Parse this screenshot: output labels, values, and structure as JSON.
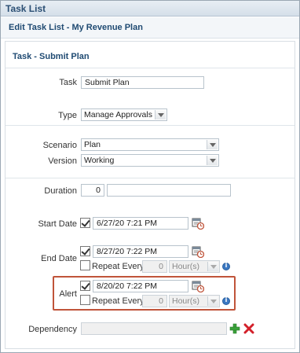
{
  "window": {
    "title": "Task List"
  },
  "header": {
    "subtitle": "Edit Task List - My Revenue Plan"
  },
  "section": {
    "title": "Task - Submit Plan"
  },
  "form": {
    "task": {
      "label": "Task",
      "value": "Submit Plan"
    },
    "type": {
      "label": "Type",
      "value": "Manage Approvals"
    },
    "scenario": {
      "label": "Scenario",
      "value": "Plan"
    },
    "version": {
      "label": "Version",
      "value": "Working"
    },
    "duration": {
      "label": "Duration",
      "value": "0",
      "unit_value": ""
    },
    "start_date": {
      "label": "Start Date",
      "checked": true,
      "value": "6/27/20 7:21 PM"
    },
    "end_date": {
      "label": "End Date",
      "checked": true,
      "value": "8/27/20 7:22 PM",
      "repeat_label": "Repeat Every",
      "repeat_checked": false,
      "repeat_value": "0",
      "repeat_unit": "Hour(s)"
    },
    "alert": {
      "label": "Alert",
      "checked": true,
      "value": "8/20/20 7:22 PM",
      "repeat_label": "Repeat Every",
      "repeat_checked": false,
      "repeat_value": "0",
      "repeat_unit": "Hour(s)"
    },
    "dependency": {
      "label": "Dependency",
      "value": ""
    }
  },
  "icons": {
    "calendar": "calendar-clock-icon",
    "info": "info-icon",
    "add": "add-icon",
    "remove": "remove-icon"
  },
  "colors": {
    "highlight_border": "#c0543a",
    "title_text": "#1f4a72",
    "info_blue": "#3b78c2"
  }
}
